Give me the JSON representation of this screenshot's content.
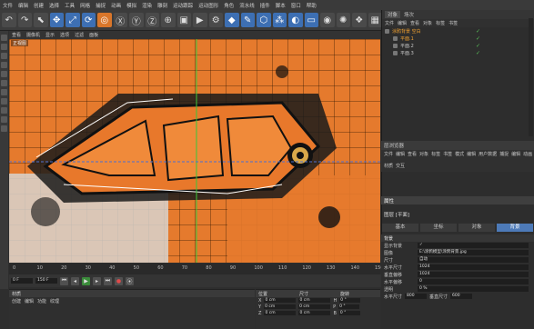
{
  "menubar": {
    "items": [
      "文件",
      "编辑",
      "创建",
      "选择",
      "工具",
      "网格",
      "捕捉",
      "动画",
      "模拟",
      "渲染",
      "雕刻",
      "运动跟踪",
      "运动图形",
      "角色",
      "流水线",
      "插件",
      "脚本",
      "窗口",
      "帮助"
    ]
  },
  "toolbar": {
    "buttons": [
      {
        "name": "undo-icon",
        "glyph": "↶",
        "style": "dark"
      },
      {
        "name": "redo-icon",
        "glyph": "↷",
        "style": "dark"
      },
      {
        "name": "select-icon",
        "glyph": "⬉",
        "style": "dark"
      },
      {
        "name": "move-icon",
        "glyph": "✥",
        "style": "blue"
      },
      {
        "name": "scale-icon",
        "glyph": "⤢",
        "style": "blue"
      },
      {
        "name": "rotate-icon",
        "glyph": "⟳",
        "style": "blue"
      },
      {
        "name": "object-mode-icon",
        "glyph": "◎",
        "style": "orange"
      },
      {
        "name": "x-axis-icon",
        "glyph": "Ⓧ",
        "style": "dark"
      },
      {
        "name": "y-axis-icon",
        "glyph": "Ⓨ",
        "style": "dark"
      },
      {
        "name": "z-axis-icon",
        "glyph": "Ⓩ",
        "style": "dark"
      },
      {
        "name": "world-coord-icon",
        "glyph": "⊕",
        "style": "dark"
      },
      {
        "name": "render-view-icon",
        "glyph": "▣",
        "style": "dark"
      },
      {
        "name": "render-picture-icon",
        "glyph": "▶",
        "style": "dark"
      },
      {
        "name": "render-settings-icon",
        "glyph": "⚙",
        "style": "dark"
      },
      {
        "name": "cube-icon",
        "glyph": "◆",
        "style": "blue"
      },
      {
        "name": "pen-icon",
        "glyph": "✎",
        "style": "blue"
      },
      {
        "name": "subdivision-icon",
        "glyph": "⬡",
        "style": "blue"
      },
      {
        "name": "array-icon",
        "glyph": "⁂",
        "style": "blue"
      },
      {
        "name": "deformer-icon",
        "glyph": "◐",
        "style": "blue"
      },
      {
        "name": "floor-icon",
        "glyph": "▭",
        "style": "blue"
      },
      {
        "name": "camera-icon",
        "glyph": "◉",
        "style": "dark"
      },
      {
        "name": "light-icon",
        "glyph": "✺",
        "style": "dark"
      },
      {
        "name": "python-icon",
        "glyph": "❖",
        "style": "dark"
      },
      {
        "name": "layout-icon",
        "glyph": "▦",
        "style": "dark"
      }
    ]
  },
  "viewport": {
    "menu": [
      "查看",
      "摄像机",
      "显示",
      "选项",
      "过滤",
      "面板"
    ],
    "label": "正视图"
  },
  "timeline": {
    "ticks": [
      "0",
      "10",
      "20",
      "30",
      "40",
      "50",
      "60",
      "70",
      "80",
      "90",
      "100",
      "110",
      "120",
      "130",
      "140",
      "150"
    ]
  },
  "transport": {
    "frame_field": "0 F",
    "end_field": "150 F"
  },
  "materials": {
    "title": "材质",
    "menu": [
      "创建",
      "编辑",
      "功能",
      "纹理"
    ]
  },
  "coordinates": {
    "title": "位置",
    "col_size": "尺寸",
    "col_rot": "旋转",
    "rows": [
      {
        "axis": "X",
        "pos": "0 cm",
        "size": "0 cm",
        "rot_label": "H",
        "rot": "0 °"
      },
      {
        "axis": "Y",
        "pos": "0 cm",
        "size": "0 cm",
        "rot_label": "P",
        "rot": "0 °"
      },
      {
        "axis": "Z",
        "pos": "0 cm",
        "size": "0 cm",
        "rot_label": "B",
        "rot": "0 °"
      }
    ]
  },
  "object_manager": {
    "tabs": [
      "对象",
      "场次"
    ],
    "menu": [
      "文件",
      "编辑",
      "查看",
      "对象",
      "标签",
      "书签"
    ],
    "objects": [
      {
        "label": "涂鸦背景 空白",
        "highlight": true
      },
      {
        "label": "平面.1",
        "highlight": true
      },
      {
        "label": "平面.2",
        "highlight": false
      },
      {
        "label": "平面.3",
        "highlight": false
      }
    ]
  },
  "layers": {
    "title": "层浏览器"
  },
  "attributes": {
    "menu": [
      "文件",
      "编辑",
      "查看",
      "对象",
      "标签",
      "书签",
      "模式",
      "编辑",
      "用户数据",
      "捕捉",
      "编辑",
      "动画",
      "材质",
      "交互"
    ],
    "title": "属性",
    "object_line": "图层 [平面]",
    "tabs": [
      "基本",
      "坐标",
      "对象",
      "背景"
    ],
    "section": "背景",
    "rows": [
      {
        "label": "显示背景",
        "value": "✓"
      },
      {
        "label": "图像",
        "value": "E:\\涂鸦模型\\涂鸦背景.jpg"
      },
      {
        "label": "尺寸",
        "value": "自动"
      },
      {
        "label": "水平尺寸",
        "value": "1024"
      },
      {
        "label": "垂直偏移",
        "value": "1024"
      },
      {
        "label": "水平偏移",
        "value": "0"
      },
      {
        "label": "透明",
        "value": "0 %"
      }
    ],
    "size_x_label": "水平尺寸",
    "size_x": "800",
    "size_y_label": "垂直尺寸",
    "size_y": "600"
  },
  "colors": {
    "viewport_orange": "#e57a2d",
    "accent_blue": "#4d7ab8",
    "highlight_orange": "#f0a030",
    "check_green": "#59c159"
  }
}
